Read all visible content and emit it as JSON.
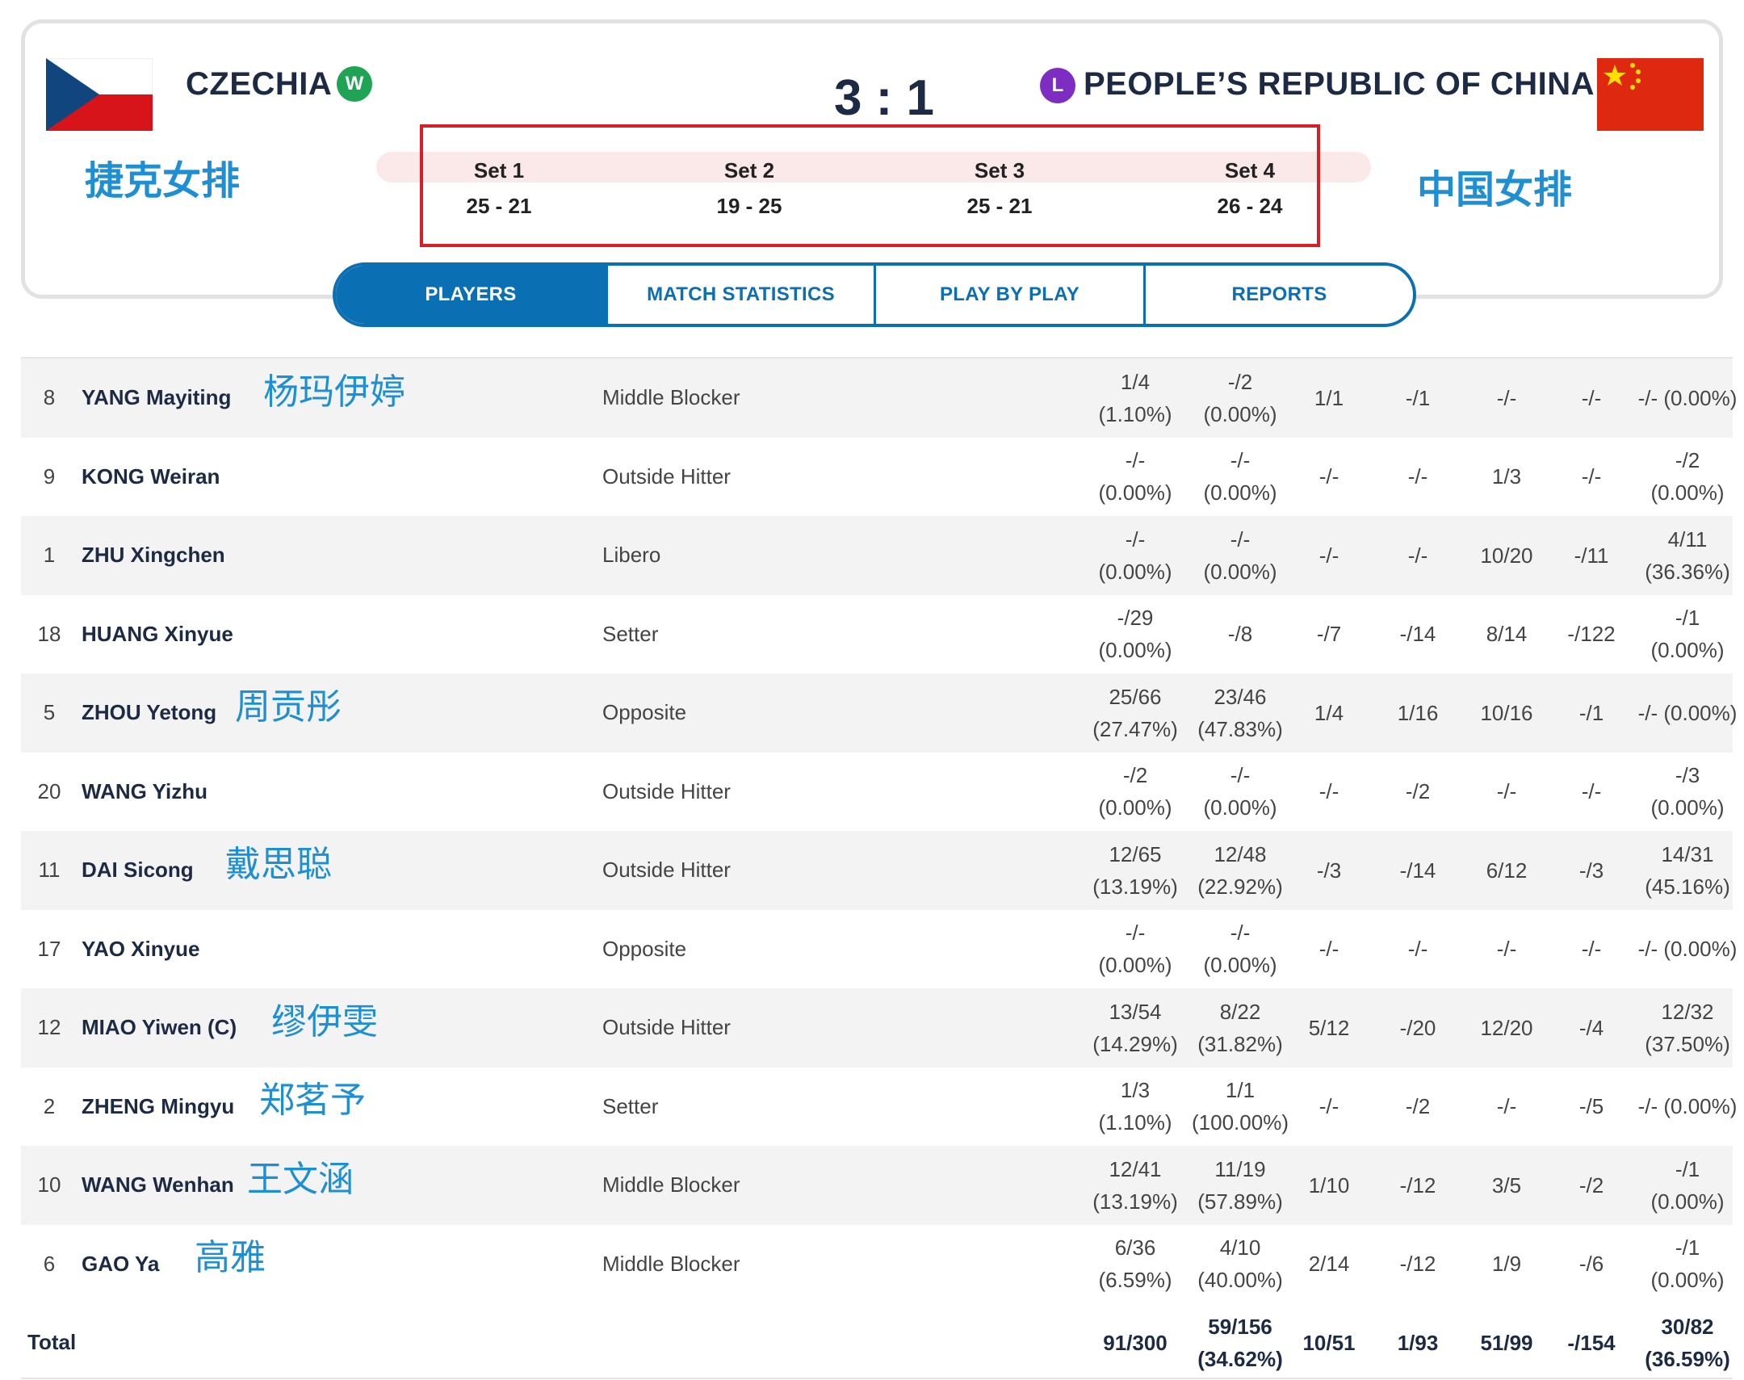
{
  "header": {
    "home_team": "CZECHIA",
    "home_badge": "W",
    "away_team": "PEOPLE’S REPUBLIC OF CHINA",
    "away_badge": "L",
    "score": "3 : 1",
    "home_cn": "捷克女排",
    "away_cn": "中国女排",
    "colors": {
      "accent": "#0b6fb4",
      "win": "#1fa355",
      "loss": "#7e2dc2",
      "highlight_box": "#d81f26",
      "annotation": "#1e8fd2"
    }
  },
  "sets": [
    {
      "name": "Set 1",
      "score": "25 - 21"
    },
    {
      "name": "Set 2",
      "score": "19 - 25"
    },
    {
      "name": "Set 3",
      "score": "25 - 21"
    },
    {
      "name": "Set 4",
      "score": "26 - 24"
    }
  ],
  "tabs": [
    {
      "label": "PLAYERS",
      "active": true
    },
    {
      "label": "MATCH STATISTICS",
      "active": false
    },
    {
      "label": "PLAY BY PLAY",
      "active": false
    },
    {
      "label": "REPORTS",
      "active": false
    }
  ],
  "players": [
    {
      "num": "8",
      "name": "YANG Mayiting",
      "cn": "杨玛伊婷",
      "pos": "Middle Blocker",
      "stats": [
        [
          "1/4",
          "(1.10%)"
        ],
        [
          "-/2",
          "(0.00%)"
        ],
        [
          "1/1"
        ],
        [
          "-/1"
        ],
        [
          "-/-"
        ],
        [
          "-/-"
        ],
        [
          "-/- (0.00%)"
        ]
      ]
    },
    {
      "num": "9",
      "name": "KONG Weiran",
      "cn": "",
      "pos": "Outside Hitter",
      "stats": [
        [
          "-/-",
          "(0.00%)"
        ],
        [
          "-/-",
          "(0.00%)"
        ],
        [
          "-/-"
        ],
        [
          "-/-"
        ],
        [
          "1/3"
        ],
        [
          "-/-"
        ],
        [
          "-/2",
          "(0.00%)"
        ]
      ]
    },
    {
      "num": "1",
      "name": "ZHU Xingchen",
      "cn": "",
      "pos": "Libero",
      "stats": [
        [
          "-/-",
          "(0.00%)"
        ],
        [
          "-/-",
          "(0.00%)"
        ],
        [
          "-/-"
        ],
        [
          "-/-"
        ],
        [
          "10/20"
        ],
        [
          "-/11"
        ],
        [
          "4/11",
          "(36.36%)"
        ]
      ]
    },
    {
      "num": "18",
      "name": "HUANG Xinyue",
      "cn": "",
      "pos": "Setter",
      "stats": [
        [
          "-/29",
          "(0.00%)"
        ],
        [
          "-/8"
        ],
        [
          "-/7"
        ],
        [
          "-/14"
        ],
        [
          "8/14"
        ],
        [
          "-/122"
        ],
        [
          "-/1",
          "(0.00%)"
        ]
      ]
    },
    {
      "num": "5",
      "name": "ZHOU Yetong",
      "cn": "周贡彤",
      "pos": "Opposite",
      "stats": [
        [
          "25/66",
          "(27.47%)"
        ],
        [
          "23/46",
          "(47.83%)"
        ],
        [
          "1/4"
        ],
        [
          "1/16"
        ],
        [
          "10/16"
        ],
        [
          "-/1"
        ],
        [
          "-/- (0.00%)"
        ]
      ]
    },
    {
      "num": "20",
      "name": "WANG Yizhu",
      "cn": "",
      "pos": "Outside Hitter",
      "stats": [
        [
          "-/2",
          "(0.00%)"
        ],
        [
          "-/-",
          "(0.00%)"
        ],
        [
          "-/-"
        ],
        [
          "-/2"
        ],
        [
          "-/-"
        ],
        [
          "-/-"
        ],
        [
          "-/3",
          "(0.00%)"
        ]
      ]
    },
    {
      "num": "11",
      "name": "DAI Sicong",
      "cn": "戴思聪",
      "pos": "Outside Hitter",
      "stats": [
        [
          "12/65",
          "(13.19%)"
        ],
        [
          "12/48",
          "(22.92%)"
        ],
        [
          "-/3"
        ],
        [
          "-/14"
        ],
        [
          "6/12"
        ],
        [
          "-/3"
        ],
        [
          "14/31",
          "(45.16%)"
        ]
      ]
    },
    {
      "num": "17",
      "name": "YAO Xinyue",
      "cn": "",
      "pos": "Opposite",
      "stats": [
        [
          "-/-",
          "(0.00%)"
        ],
        [
          "-/-",
          "(0.00%)"
        ],
        [
          "-/-"
        ],
        [
          "-/-"
        ],
        [
          "-/-"
        ],
        [
          "-/-"
        ],
        [
          "-/- (0.00%)"
        ]
      ]
    },
    {
      "num": "12",
      "name": "MIAO Yiwen (C)",
      "cn": "缪伊雯",
      "pos": "Outside Hitter",
      "stats": [
        [
          "13/54",
          "(14.29%)"
        ],
        [
          "8/22",
          "(31.82%)"
        ],
        [
          "5/12"
        ],
        [
          "-/20"
        ],
        [
          "12/20"
        ],
        [
          "-/4"
        ],
        [
          "12/32",
          "(37.50%)"
        ]
      ]
    },
    {
      "num": "2",
      "name": "ZHENG Mingyu",
      "cn": "郑茗予",
      "pos": "Setter",
      "stats": [
        [
          "1/3",
          "(1.10%)"
        ],
        [
          "1/1",
          "(100.00%)"
        ],
        [
          "-/-"
        ],
        [
          "-/2"
        ],
        [
          "-/-"
        ],
        [
          "-/5"
        ],
        [
          "-/- (0.00%)"
        ]
      ]
    },
    {
      "num": "10",
      "name": "WANG Wenhan",
      "cn": "王文涵",
      "pos": "Middle Blocker",
      "stats": [
        [
          "12/41",
          "(13.19%)"
        ],
        [
          "11/19",
          "(57.89%)"
        ],
        [
          "1/10"
        ],
        [
          "-/12"
        ],
        [
          "3/5"
        ],
        [
          "-/2"
        ],
        [
          "-/1",
          "(0.00%)"
        ]
      ]
    },
    {
      "num": "6",
      "name": "GAO Ya",
      "cn": "高雅",
      "pos": "Middle Blocker",
      "stats": [
        [
          "6/36",
          "(6.59%)"
        ],
        [
          "4/10",
          "(40.00%)"
        ],
        [
          "2/14"
        ],
        [
          "-/12"
        ],
        [
          "1/9"
        ],
        [
          "-/6"
        ],
        [
          "-/1",
          "(0.00%)"
        ]
      ]
    }
  ],
  "total": {
    "label": "Total",
    "stats": [
      [
        "91/300"
      ],
      [
        "59/156",
        "(34.62%)"
      ],
      [
        "10/51"
      ],
      [
        "1/93"
      ],
      [
        "51/99"
      ],
      [
        "-/154"
      ],
      [
        "30/82",
        "(36.59%)"
      ]
    ]
  }
}
